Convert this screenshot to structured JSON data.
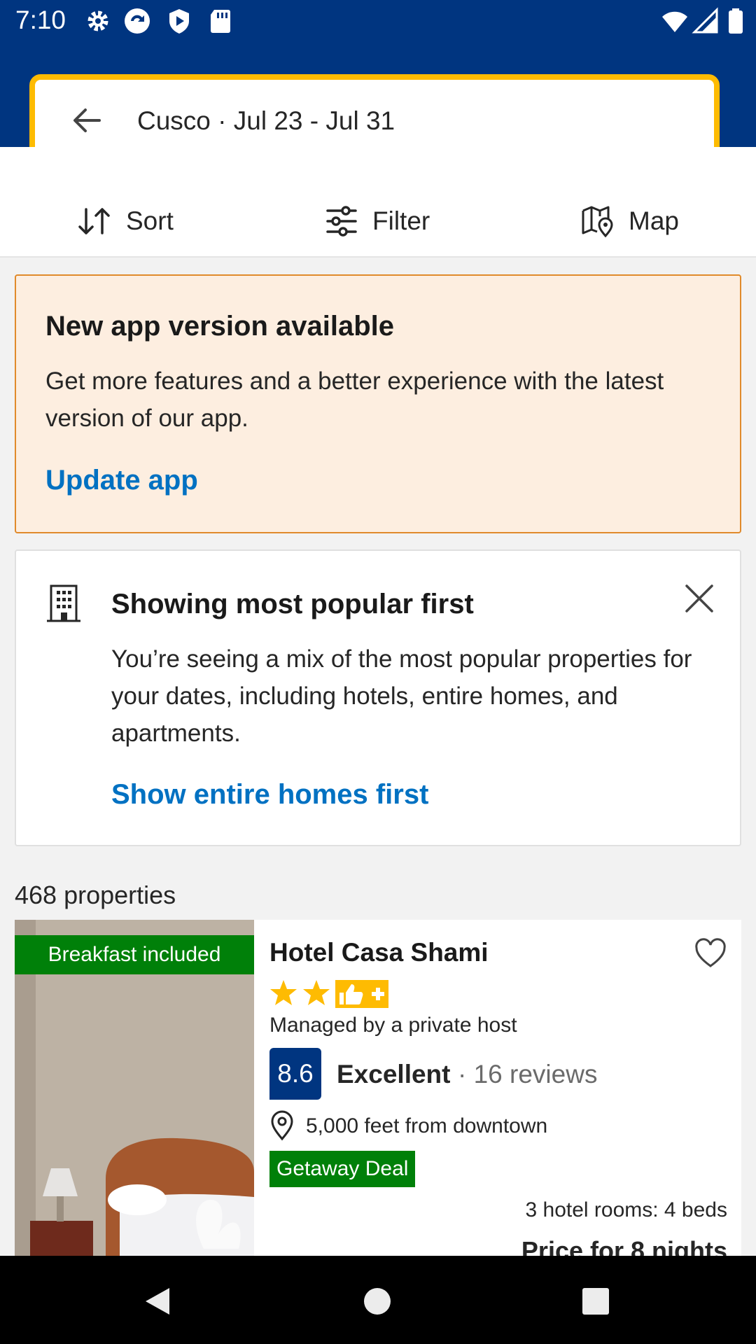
{
  "status_bar": {
    "time": "7:10"
  },
  "search": {
    "location_dates": "Cusco · Jul 23 - Jul 31"
  },
  "toolbar": {
    "sort_label": "Sort",
    "filter_label": "Filter",
    "map_label": "Map"
  },
  "update_banner": {
    "title": "New app version available",
    "body": "Get more features and a better experience with the latest version of our app.",
    "link": "Update app"
  },
  "popular_card": {
    "title": "Showing most popular first",
    "body": "You’re seeing a mix of the most popular properties for your dates, including hotels, entire homes, and apartments.",
    "link": "Show entire homes first"
  },
  "results": {
    "count": "468 properties"
  },
  "property": {
    "badge": "Breakfast included",
    "name": "Hotel Casa Shami",
    "stars": 2,
    "host": "Managed by a private host",
    "score": "8.6",
    "score_word": "Excellent",
    "reviews": "· 16 reviews",
    "distance": "5,000 feet from downtown",
    "deal": "Getaway Deal",
    "rooms": "3 hotel rooms: 4 beds",
    "price_label": "Price for 8 nights"
  },
  "colors": {
    "brand": "#003580",
    "search_border": "#febb02",
    "link": "#0071c2",
    "deal_green": "#008009",
    "banner_bg": "#fdeee0"
  }
}
